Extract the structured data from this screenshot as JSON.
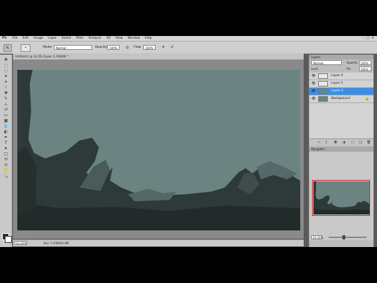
{
  "menubar": {
    "logo": "Ps",
    "items": [
      "File",
      "Edit",
      "Image",
      "Layer",
      "Select",
      "Filter",
      "Analysis",
      "3D",
      "View",
      "Window",
      "Help"
    ],
    "controls": [
      "–",
      "□",
      "×"
    ]
  },
  "options": {
    "mode_label": "Mode:",
    "mode_value": "Normal",
    "opacity_label": "Opacity:",
    "opacity_value": "100%",
    "flow_label": "Flow:",
    "flow_value": "100%"
  },
  "document": {
    "tab_title": "Untitled-1 @ 33.3% (Layer 3, RGB/8) *",
    "zoom": "33.33%",
    "doc_info": "Doc: 5.93M/45.8M"
  },
  "layers_panel": {
    "tab": "Layers",
    "blend_mode": "Normal",
    "opacity_label": "Opacity:",
    "opacity_value": "100%",
    "lock_label": "Lock:",
    "fill_label": "Fill:",
    "fill_value": "100%",
    "layers": [
      {
        "name": "Layer 4",
        "thumb_color": "#e8e8e8",
        "active": false
      },
      {
        "name": "Layer 1",
        "thumb_color": "#e8e8e8",
        "active": false
      },
      {
        "name": "Layer 3",
        "thumb_color": "#6b8482",
        "active": true
      },
      {
        "name": "Background",
        "thumb_color": "#6b8482",
        "active": false
      }
    ]
  },
  "navigator": {
    "tab": "Navigator",
    "zoom": "33.33%"
  },
  "colors": {
    "sky": "#6b8482",
    "foreground_swatch": "#2a3130",
    "background_swatch": "#ffffff",
    "selection": "#3d8ee0",
    "nav_view_box": "#e02020"
  }
}
